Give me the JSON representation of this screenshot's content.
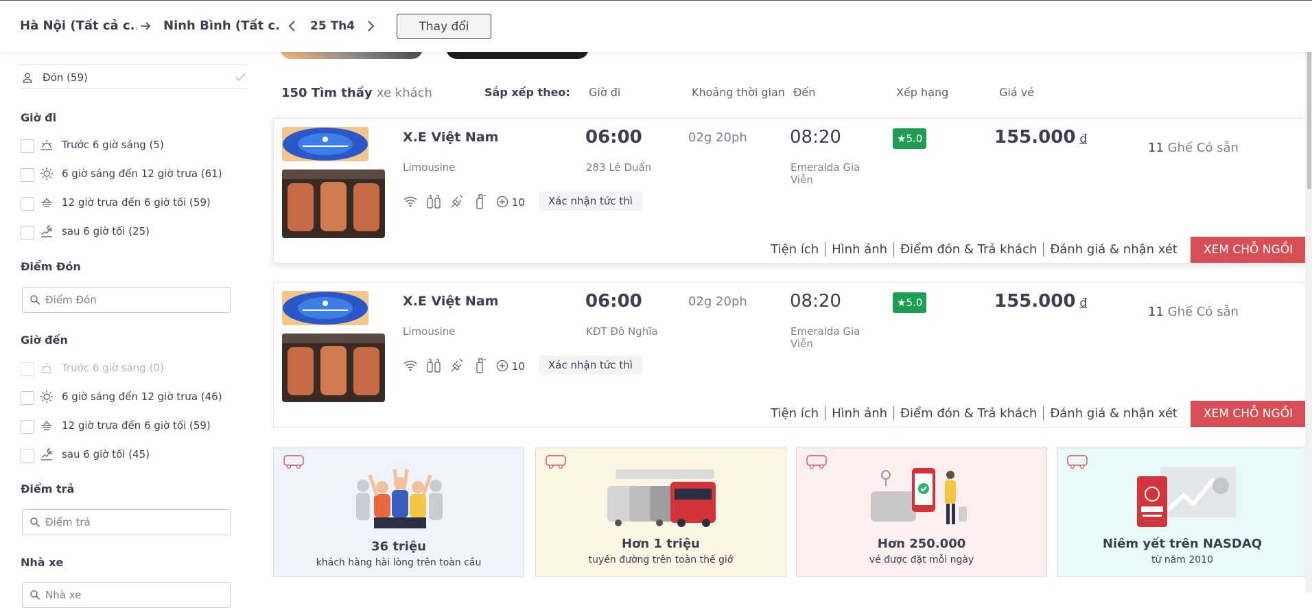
{
  "header": {
    "from": "Hà Nội (Tất cả c...",
    "to": "Ninh Bình (Tất c...",
    "date": "25 Th4",
    "change_button": "Thay đổi"
  },
  "sidebar": {
    "pickup_count_label": "Đón (59)",
    "departure_time": {
      "title": "Giờ đi",
      "options": [
        {
          "label": "Trước 6 giờ sáng (5)",
          "icon": "sunrise-icon"
        },
        {
          "label": "6 giờ sáng đến 12 giờ trưa (61)",
          "icon": "sun-icon"
        },
        {
          "label": "12 giờ trưa đến 6 giờ tối (59)",
          "icon": "sunset-icon"
        },
        {
          "label": "sau 6 giờ tối (25)",
          "icon": "night-icon"
        }
      ]
    },
    "pickup_point": {
      "title": "Điểm Đón",
      "placeholder": "Điểm Đón"
    },
    "arrival_time": {
      "title": "Giờ đến",
      "options": [
        {
          "label": "Trước 6 giờ sáng (0)",
          "icon": "sunrise-icon",
          "disabled": true
        },
        {
          "label": "6 giờ sáng đến 12 giờ trưa (46)",
          "icon": "sun-icon"
        },
        {
          "label": "12 giờ trưa đến 6 giờ tối (59)",
          "icon": "sunset-icon"
        },
        {
          "label": "sau 6 giờ tối (45)",
          "icon": "night-icon"
        }
      ]
    },
    "drop_point": {
      "title": "Điểm trả",
      "placeholder": "Điểm trả"
    },
    "operator": {
      "title": "Nhà xe",
      "placeholder": "Nhà xe"
    }
  },
  "results": {
    "count": "150 Tìm thấy",
    "count_suffix": "xe khách",
    "sort_label": "Sắp xếp theo:",
    "sort_columns": [
      "Giờ đi",
      "Khoảng thời gian",
      "Đến",
      "Xếp hạng",
      "Giá vé"
    ]
  },
  "buses": [
    {
      "operator": "X.E Việt Nam",
      "type": "Limousine",
      "departure": "06:00",
      "departure_point": "283 Lê Duẩn",
      "duration": "02g 20ph",
      "arrival": "08:20",
      "arrival_point": "Emeralda Gia Viễn",
      "rating": "5.0",
      "price": "155.000",
      "currency": "đ",
      "seats_count": "11",
      "seats_label": "Ghế Có sẵn",
      "amenities_more": "10",
      "instant_label": "Xác nhận tức thì",
      "links": [
        "Tiện ích",
        "Hình ảnh",
        "Điểm đón & Trả khách",
        "Đánh giá & nhận xét"
      ],
      "view_button": "XEM CHỖ NGỒI"
    },
    {
      "operator": "X.E Việt Nam",
      "type": "Limousine",
      "departure": "06:00",
      "departure_point": "KĐT Đô Nghĩa",
      "duration": "02g 20ph",
      "arrival": "08:20",
      "arrival_point": "Emeralda Gia Viễn",
      "rating": "5.0",
      "price": "155.000",
      "currency": "đ",
      "seats_count": "11",
      "seats_label": "Ghế Có sẵn",
      "amenities_more": "10",
      "instant_label": "Xác nhận tức thì",
      "links": [
        "Tiện ích",
        "Hình ảnh",
        "Điểm đón & Trả khách",
        "Đánh giá & nhận xét"
      ],
      "view_button": "XEM CHỖ NGỒI"
    }
  ],
  "promos": [
    {
      "title": "36 triệu",
      "subtitle": "khách hàng hài lòng trên toàn cầu",
      "bg": "#eef3fc"
    },
    {
      "title": "Hơn 1 triệu",
      "subtitle": "tuyến đường trên toàn thế giớ",
      "bg": "#fdf6e4"
    },
    {
      "title": "Hơn 250.000",
      "subtitle": "vé được đặt mỗi ngày",
      "bg": "#fbeff0"
    },
    {
      "title": "Niêm yết trên NASDAQ",
      "subtitle": "từ năm 2010",
      "bg": "#e9fbf8"
    }
  ],
  "colors": {
    "accent_red": "#d84e55",
    "rating_green": "#1f9d55"
  }
}
